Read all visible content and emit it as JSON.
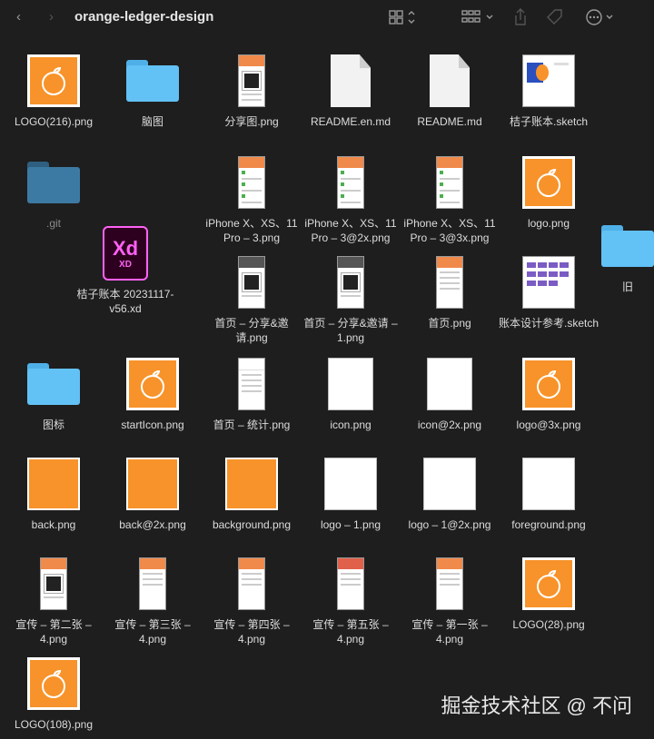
{
  "window": {
    "title": "orange-ledger-design"
  },
  "toolbar": {
    "back": "‹",
    "forward": "›",
    "view_icon": "grid-view-icon",
    "group_icon": "group-icon",
    "share_icon": "share-icon",
    "tag_icon": "tag-icon",
    "more_icon": "more-icon"
  },
  "files": {
    "r1": [
      "LOGO(216).png",
      "脑图",
      "分享图.png",
      "README.en.md",
      "README.md",
      "桔子账本.sketch"
    ],
    "r2": [
      ".git",
      "iPhone X、XS、11 Pro – 3.png",
      "iPhone X、XS、11 Pro – 3@2x.png",
      "iPhone X、XS、11 Pro – 3@3x.png",
      "logo.png",
      "旧"
    ],
    "xd": "桔子账本 20231117-v56.xd",
    "r3": [
      "首页 – 分享&邀请.png",
      "首页 – 分享&邀请 – 1.png",
      "首页.png",
      "账本设计参考.sketch"
    ],
    "r4": [
      "图标",
      "startIcon.png",
      "首页 – 统计.png",
      "icon.png",
      "icon@2x.png",
      "logo@3x.png"
    ],
    "r5": [
      "back.png",
      "back@2x.png",
      "background.png",
      "logo – 1.png",
      "logo – 1@2x.png",
      "foreground.png"
    ],
    "r6": [
      "宣传 – 第二张 – 4.png",
      "宣传 – 第三张 – 4.png",
      "宣传 – 第四张 – 4.png",
      "宣传 – 第五张 – 4.png",
      "宣传 – 第一张 – 4.png",
      "LOGO(28).png"
    ],
    "r7": [
      "LOGO(108).png"
    ]
  },
  "xd_badge": {
    "big": "Xd",
    "small": "XD"
  },
  "watermark": "掘金技术社区 @ 不问",
  "colors": {
    "accent": "#f7932a",
    "folder": "#62c1f5",
    "background": "#1e1e1e"
  }
}
